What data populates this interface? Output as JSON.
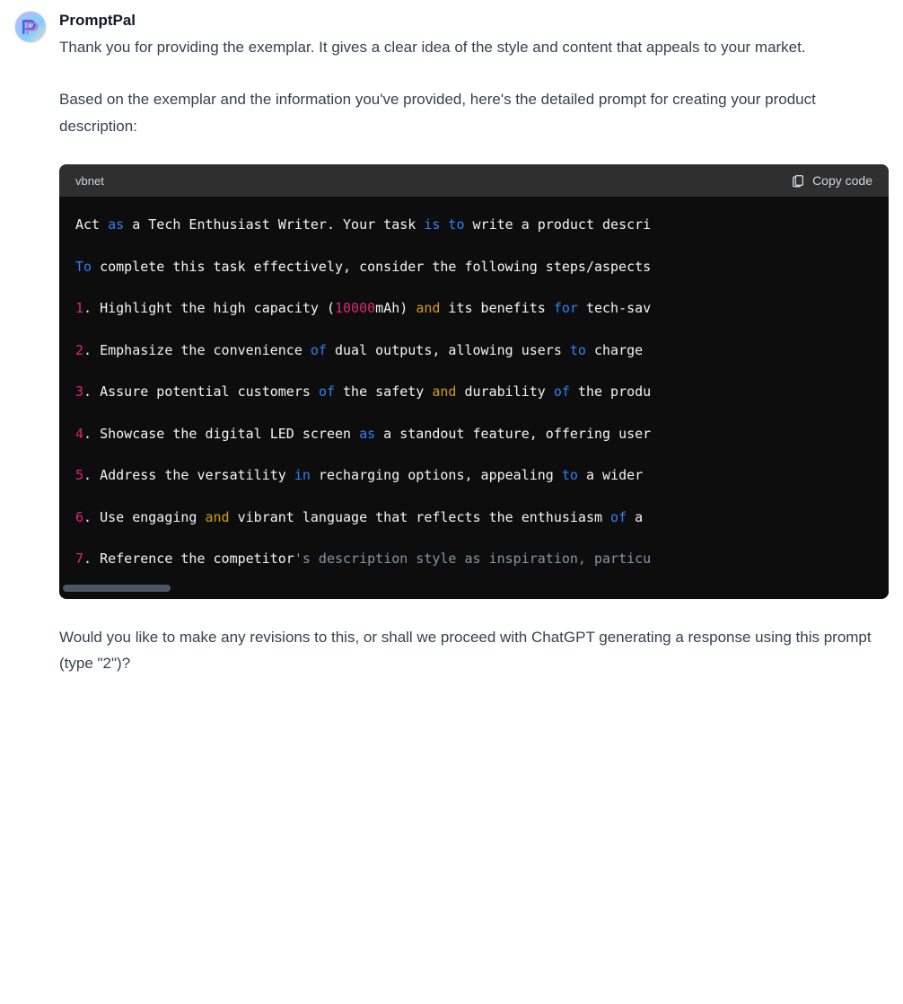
{
  "sender": "PromptPal",
  "intro_p1": "Thank you for providing the exemplar. It gives a clear idea of the style and content that appeals to your market.",
  "intro_p2": "Based on the exemplar and the information you've provided, here's the detailed prompt for creating your product description:",
  "code": {
    "language": "vbnet",
    "copy_label": "Copy code",
    "lines": [
      {
        "tokens": [
          {
            "t": "Act "
          },
          {
            "t": "as",
            "c": "tok-keyword"
          },
          {
            "t": " a Tech Enthusiast Writer. Your task "
          },
          {
            "t": "is",
            "c": "tok-keyword"
          },
          {
            "t": " "
          },
          {
            "t": "to",
            "c": "tok-keyword"
          },
          {
            "t": " write a product descri"
          }
        ]
      },
      {
        "tokens": []
      },
      {
        "tokens": [
          {
            "t": "To",
            "c": "tok-keyword"
          },
          {
            "t": " complete this task effectively, consider the following steps/aspects"
          }
        ]
      },
      {
        "tokens": []
      },
      {
        "tokens": [
          {
            "t": "1",
            "c": "tok-num"
          },
          {
            "t": ". Highlight the high capacity ("
          },
          {
            "t": "10000",
            "c": "tok-num"
          },
          {
            "t": "mAh) "
          },
          {
            "t": "and",
            "c": "tok-and"
          },
          {
            "t": " its benefits "
          },
          {
            "t": "for",
            "c": "tok-keyword"
          },
          {
            "t": " tech-sav"
          }
        ]
      },
      {
        "tokens": []
      },
      {
        "tokens": [
          {
            "t": "2",
            "c": "tok-num"
          },
          {
            "t": ". Emphasize the convenience "
          },
          {
            "t": "of",
            "c": "tok-keyword"
          },
          {
            "t": " dual outputs, allowing users "
          },
          {
            "t": "to",
            "c": "tok-keyword"
          },
          {
            "t": " charge "
          }
        ]
      },
      {
        "tokens": []
      },
      {
        "tokens": [
          {
            "t": "3",
            "c": "tok-num"
          },
          {
            "t": ". Assure potential customers "
          },
          {
            "t": "of",
            "c": "tok-keyword"
          },
          {
            "t": " the safety "
          },
          {
            "t": "and",
            "c": "tok-and"
          },
          {
            "t": " durability "
          },
          {
            "t": "of",
            "c": "tok-keyword"
          },
          {
            "t": " the produ"
          }
        ]
      },
      {
        "tokens": []
      },
      {
        "tokens": [
          {
            "t": "4",
            "c": "tok-num"
          },
          {
            "t": ". Showcase the digital LED screen "
          },
          {
            "t": "as",
            "c": "tok-keyword"
          },
          {
            "t": " a standout feature, offering user"
          }
        ]
      },
      {
        "tokens": []
      },
      {
        "tokens": [
          {
            "t": "5",
            "c": "tok-num"
          },
          {
            "t": ". Address the versatility "
          },
          {
            "t": "in",
            "c": "tok-keyword"
          },
          {
            "t": " recharging options, appealing "
          },
          {
            "t": "to",
            "c": "tok-keyword"
          },
          {
            "t": " a wider "
          }
        ]
      },
      {
        "tokens": []
      },
      {
        "tokens": [
          {
            "t": "6",
            "c": "tok-num"
          },
          {
            "t": ". Use engaging "
          },
          {
            "t": "and",
            "c": "tok-and"
          },
          {
            "t": " vibrant language that reflects the enthusiasm "
          },
          {
            "t": "of",
            "c": "tok-keyword"
          },
          {
            "t": " a "
          }
        ]
      },
      {
        "tokens": []
      },
      {
        "tokens": [
          {
            "t": "7",
            "c": "tok-num"
          },
          {
            "t": ". Reference the competitor"
          },
          {
            "t": "'s description style as inspiration, particu",
            "c": "tok-comment"
          }
        ]
      }
    ]
  },
  "outro": "Would you like to make any revisions to this, or shall we proceed with ChatGPT generating a response using this prompt (type \"2\")?"
}
